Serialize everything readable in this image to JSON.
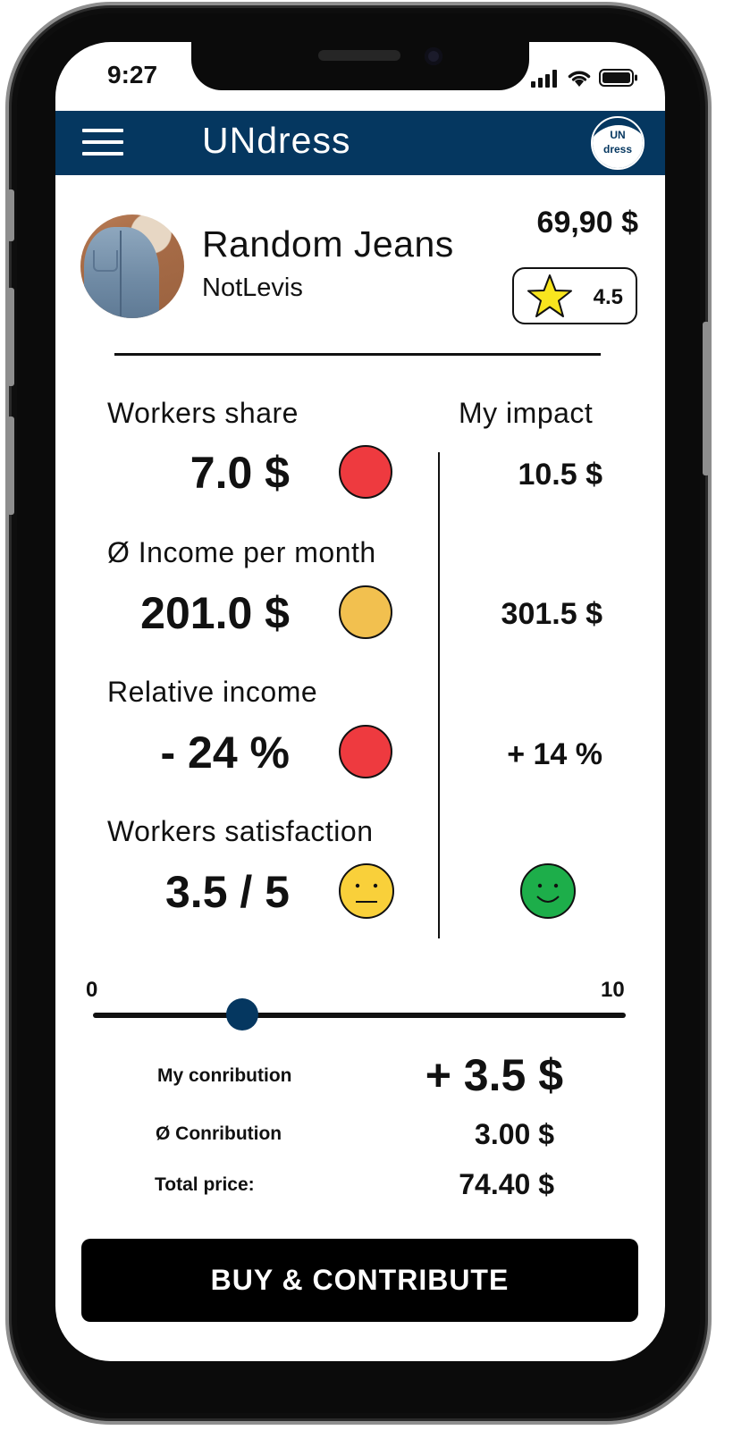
{
  "status_bar": {
    "time": "9:27"
  },
  "app": {
    "title": "UNdress",
    "logo_line1": "UN",
    "logo_line2": "dress"
  },
  "product": {
    "name": "Random Jeans",
    "brand": "NotLevis",
    "price": "69,90 $",
    "rating": "4.5"
  },
  "metrics": {
    "impact_header": "My impact",
    "rows": [
      {
        "label": "Workers share",
        "value": "7.0 $",
        "status_color": "#EE3A3F",
        "impact": "10.5 $"
      },
      {
        "label": "Ø Income per month",
        "value": "201.0 $",
        "status_color": "#F2C04F",
        "impact": "301.5 $"
      },
      {
        "label": "Relative income",
        "value": "- 24 %",
        "status_color": "#EE3A3F",
        "impact": "+ 14 %"
      },
      {
        "label": "Workers satisfaction",
        "value": "3.5 / 5",
        "status_icon": "neutral-face-icon",
        "status_color": "#F9D03A",
        "impact_icon": "smiling-face-icon",
        "impact_color": "#1DAE4A"
      }
    ]
  },
  "slider": {
    "min": "0",
    "max": "10",
    "value": 2.8
  },
  "contribution": {
    "my_label": "My conribution",
    "my_value": "+ 3.5 $",
    "avg_label": "Ø Conribution",
    "avg_value": "3.00 $",
    "total_label": "Total price:",
    "total_value": "74.40 $"
  },
  "buy_button": {
    "label": "BUY & CONTRIBUTE"
  },
  "colors": {
    "brand": "#053760",
    "red": "#EE3A3F",
    "amber": "#F2C04F",
    "green": "#1DAE4A"
  }
}
